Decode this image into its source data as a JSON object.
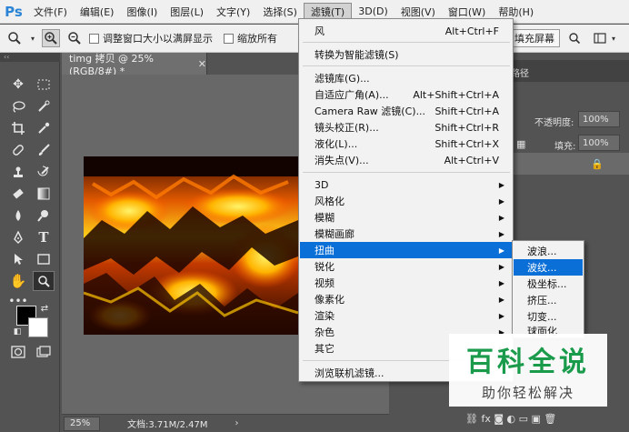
{
  "app": {
    "logo": "Ps"
  },
  "menubar": {
    "items": [
      "文件(F)",
      "编辑(E)",
      "图像(I)",
      "图层(L)",
      "文字(Y)",
      "选择(S)",
      "滤镜(T)",
      "3D(D)",
      "视图(V)",
      "窗口(W)",
      "帮助(H)"
    ]
  },
  "options": {
    "resize_windows": "调整窗口大小以满屏显示",
    "zoom_all": "缩放所有",
    "fill_screen": "填充屏幕"
  },
  "document": {
    "tab_title": "timg 拷贝 @ 25%(RGB/8#) *",
    "zoom": "25%",
    "doc_info": "文档:3.71M/2.47M",
    "status_arrow": "›"
  },
  "panels": {
    "tab_partial": "路径",
    "opacity_label": "不透明度:",
    "opacity_value": "100%",
    "fill_label": "填充:",
    "fill_value": "100%"
  },
  "filter_menu": {
    "groups": [
      [
        {
          "label": "风",
          "shortcut": "Alt+Ctrl+F"
        }
      ],
      [
        {
          "label": "转换为智能滤镜(S)",
          "shortcut": ""
        }
      ],
      [
        {
          "label": "滤镜库(G)...",
          "shortcut": ""
        },
        {
          "label": "自适应广角(A)...",
          "shortcut": "Alt+Shift+Ctrl+A"
        },
        {
          "label": "Camera Raw 滤镜(C)...",
          "shortcut": "Shift+Ctrl+A"
        },
        {
          "label": "镜头校正(R)...",
          "shortcut": "Shift+Ctrl+R"
        },
        {
          "label": "液化(L)...",
          "shortcut": "Shift+Ctrl+X"
        },
        {
          "label": "消失点(V)...",
          "shortcut": "Alt+Ctrl+V"
        }
      ],
      [
        {
          "label": "3D",
          "submenu": true
        },
        {
          "label": "风格化",
          "submenu": true
        },
        {
          "label": "模糊",
          "submenu": true
        },
        {
          "label": "模糊画廊",
          "submenu": true
        },
        {
          "label": "扭曲",
          "submenu": true,
          "highlight": true
        },
        {
          "label": "锐化",
          "submenu": true
        },
        {
          "label": "视频",
          "submenu": true
        },
        {
          "label": "像素化",
          "submenu": true
        },
        {
          "label": "渲染",
          "submenu": true
        },
        {
          "label": "杂色",
          "submenu": true
        },
        {
          "label": "其它",
          "submenu": true
        }
      ],
      [
        {
          "label": "浏览联机滤镜...",
          "shortcut": ""
        }
      ]
    ]
  },
  "distort_submenu": {
    "items": [
      {
        "label": "波浪..."
      },
      {
        "label": "波纹...",
        "highlight": true
      },
      {
        "label": "极坐标..."
      },
      {
        "label": "挤压..."
      },
      {
        "label": "切变..."
      },
      {
        "label": "球面化"
      }
    ]
  },
  "watermark": {
    "title": "百科全说",
    "subtitle": "助你轻松解决"
  },
  "colors": {
    "menu_highlight": "#0a6fd6",
    "ps_blue": "#2b84d6",
    "watermark_green": "#1a9b4c"
  }
}
